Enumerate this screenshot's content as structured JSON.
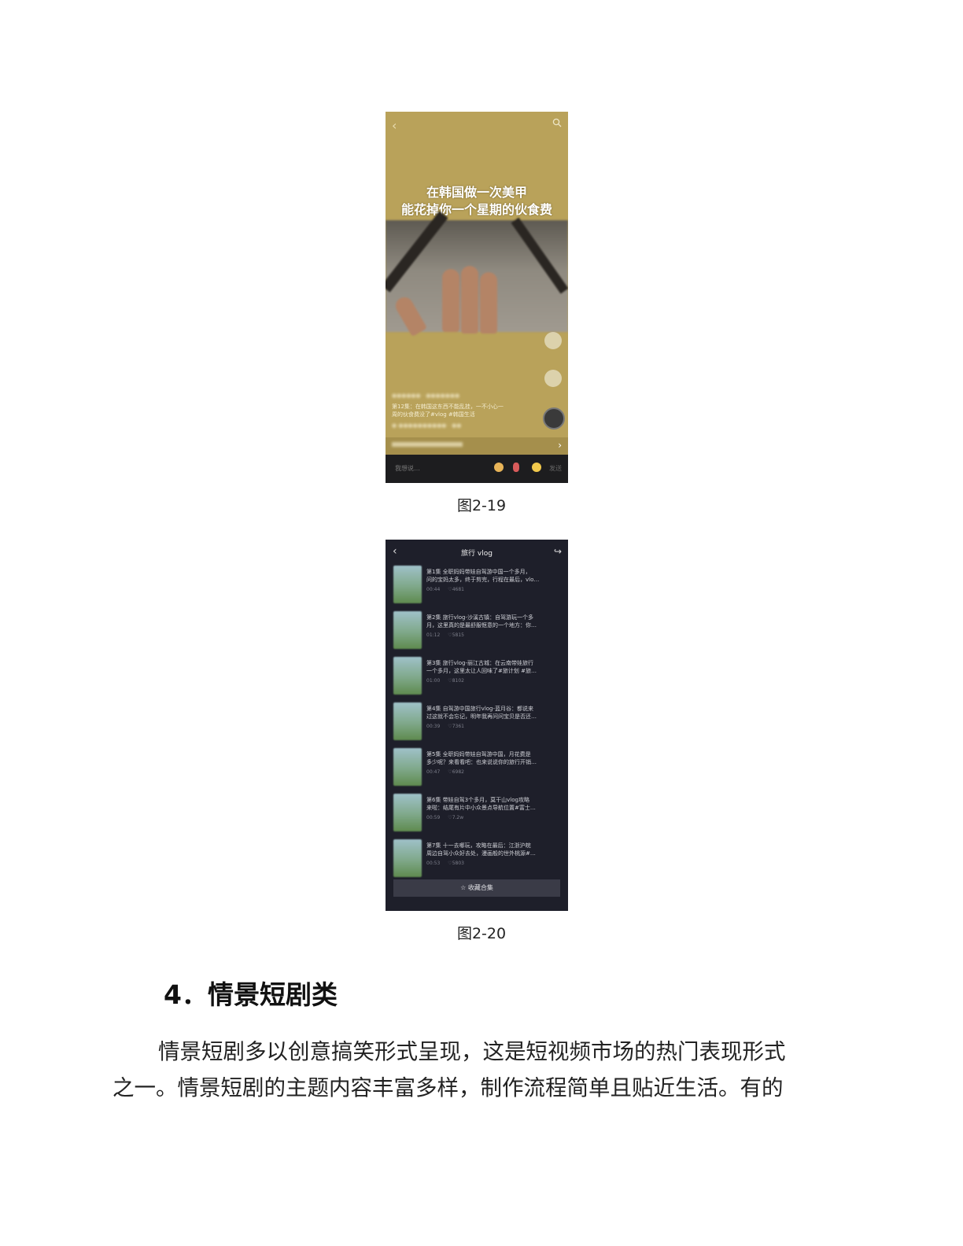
{
  "figure1": {
    "caption": "图2-19",
    "overlay_text_line1": "在韩国做一次美甲",
    "overlay_text_line2": "能花掉你一个星期的伙食费",
    "episode_text_line1": "第12集：在韩国这东西不能乱挂，一不小心一",
    "episode_text_line2": "周的伙食费没了#vlog #韩国生活",
    "input_placeholder": "我想说…",
    "send_label": "发送"
  },
  "figure2": {
    "caption": "图2-20",
    "title": "旅行 vlog",
    "items": [
      {
        "line1": "第1集  全职妈妈带娃自驾游中国一个多月，",
        "line2": "问的宝妈太多，终于剪完，行程在最后，vlo…",
        "duration": "00:44",
        "likes": "4681"
      },
      {
        "line1": "第2集  旅行vlog-沙溪古镇：自驾游玩一个多",
        "line2": "月，这里真的是最舒服惬意的一个地方：你…",
        "duration": "01:12",
        "likes": "5815"
      },
      {
        "line1": "第3集  旅行vlog-丽江古城：在云南带娃旅行",
        "line2": "一个多月，这里太让人回味了#旅计划 #旅…",
        "duration": "01:00",
        "likes": "8102"
      },
      {
        "line1": "第4集  自驾游中国旅行vlog-蓝月谷：都说来",
        "line2": "过这就不会忘记，明年我再问问宝贝是否还…",
        "duration": "00:39",
        "likes": "7361"
      },
      {
        "line1": "第5集  全职妈妈带娃自驾游中国，月花费是",
        "line2": "多少呢？来看看吧：也来说说你的旅行开销…",
        "duration": "00:47",
        "likes": "6982"
      },
      {
        "line1": "第6集  带娃自驾3个多月，莫干山vlog攻略",
        "line2": "来啦：结尾有片中小众景点导航位置#富士…",
        "duration": "00:59",
        "likes": "7.2w"
      },
      {
        "line1": "第7集  十一去哪玩，攻略在最后：江浙沪皖",
        "line2": "周边自驾小众好去处，漫画般的世外桃源#…",
        "duration": "00:53",
        "likes": "5803"
      }
    ],
    "collect_button": "☆ 收藏合集"
  },
  "section": {
    "heading": "4．情景短剧类",
    "para_line1": "情景短剧多以创意搞笑形式呈现，这是短视频市场的热门表现形式",
    "para_line2": "之一。情景短剧的主题内容丰富多样，制作流程简单且贴近生活。有的"
  }
}
